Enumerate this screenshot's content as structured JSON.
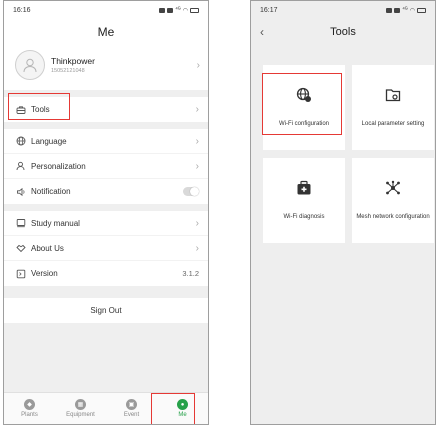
{
  "left_screen": {
    "status": {
      "time": "16:16"
    },
    "title": "Me",
    "profile": {
      "name": "Thinkpower",
      "id": "15052121048"
    },
    "menu": [
      {
        "label": "Tools",
        "icon": "toolbox-icon"
      },
      {
        "label": "Language",
        "icon": "globe-icon"
      },
      {
        "label": "Personalization",
        "icon": "person-icon"
      },
      {
        "label": "Notification",
        "icon": "speaker-icon"
      },
      {
        "label": "Study manual",
        "icon": "book-icon"
      },
      {
        "label": "About Us",
        "icon": "handshake-icon"
      },
      {
        "label": "Version",
        "icon": "version-icon",
        "value": "3.1.2"
      }
    ],
    "sign_out": "Sign Out",
    "tabs": [
      {
        "label": "Plants",
        "icon": "compass-icon"
      },
      {
        "label": "Equipment",
        "icon": "equipment-icon"
      },
      {
        "label": "Event",
        "icon": "event-icon"
      },
      {
        "label": "Me",
        "icon": "user-icon",
        "active": true
      }
    ],
    "accent_color": "#27a14a",
    "highlight_color": "#e53935"
  },
  "right_screen": {
    "status": {
      "time": "16:17"
    },
    "title": "Tools",
    "tools": [
      {
        "label": "Wi-Fi configuration",
        "icon": "wifi-globe-icon"
      },
      {
        "label": "Local parameter setting",
        "icon": "folder-gear-icon"
      },
      {
        "label": "Wi-Fi diagnosis",
        "icon": "medical-kit-icon"
      },
      {
        "label": "Mesh network configuration",
        "icon": "mesh-network-icon"
      }
    ]
  }
}
